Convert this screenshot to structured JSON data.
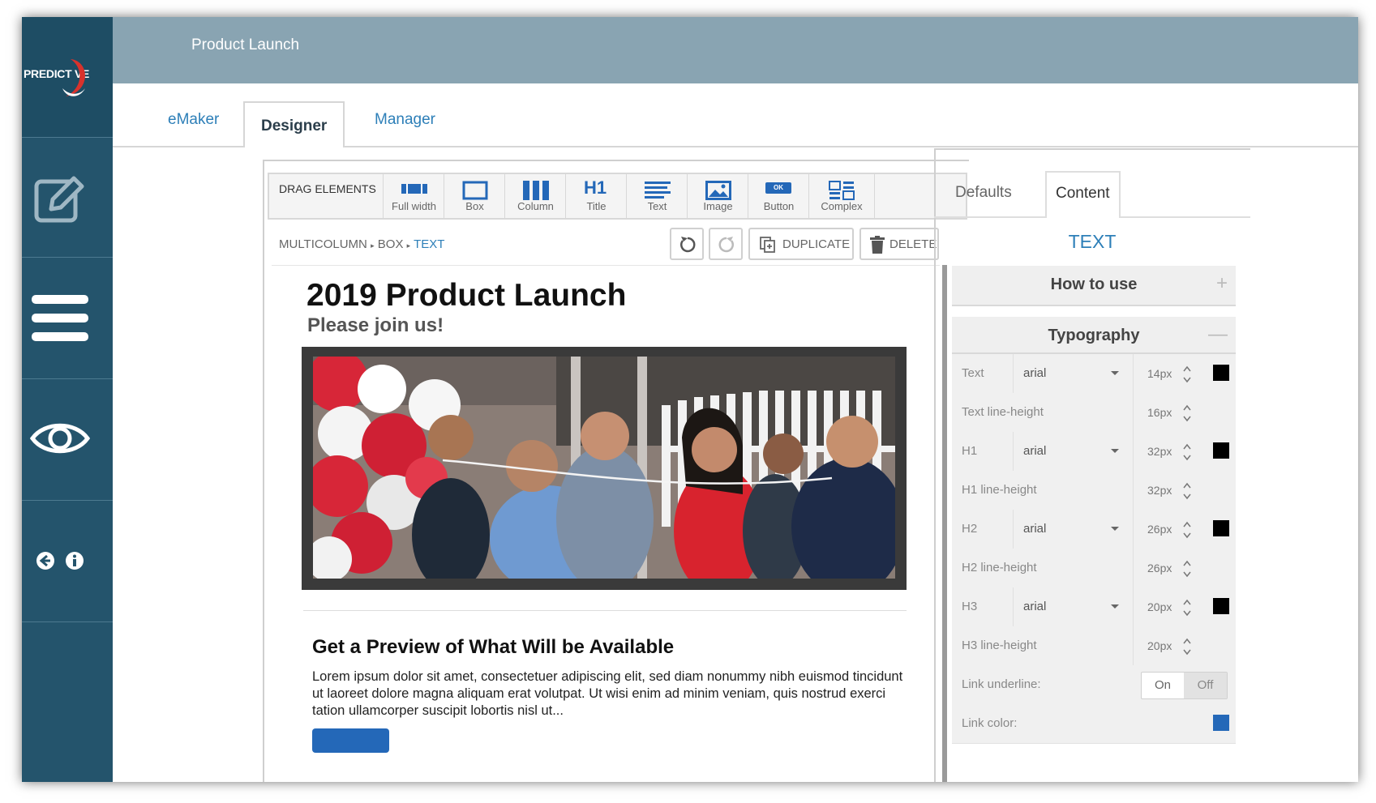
{
  "header": {
    "title": "Product Launch"
  },
  "logo": {
    "text": "PREDICT VE"
  },
  "tabs": [
    {
      "label": "eMaker"
    },
    {
      "label": "Designer"
    },
    {
      "label": "Manager"
    }
  ],
  "toolbar": {
    "drag_label": "DRAG ELEMENTS",
    "tools": [
      {
        "label": "Full width",
        "icon": "full-width-icon"
      },
      {
        "label": "Box",
        "icon": "box-icon"
      },
      {
        "label": "Column",
        "icon": "column-icon"
      },
      {
        "label": "Title",
        "icon": "h1-title-icon",
        "glyph": "H1"
      },
      {
        "label": "Text",
        "icon": "text-lines-icon"
      },
      {
        "label": "Image",
        "icon": "image-icon"
      },
      {
        "label": "Button",
        "icon": "button-icon",
        "glyph": "OK"
      },
      {
        "label": "Complex",
        "icon": "complex-icon"
      }
    ]
  },
  "breadcrumb": {
    "items": [
      "MULTICOLUMN",
      "BOX"
    ],
    "current": "TEXT"
  },
  "actions": {
    "duplicate": "DUPLICATE",
    "delete": "DELETE"
  },
  "email": {
    "title": "2019 Product Launch",
    "subtitle": "Please join us!",
    "section_title": "Get a Preview of What Will be Available",
    "body": "Lorem ipsum dolor sit amet, consectetuer adipiscing elit, sed diam nonummy nibh euismod tincidunt ut laoreet dolore magna aliquam erat volutpat. Ut wisi enim ad minim veniam, quis nostrud exerci tation ullamcorper suscipit lobortis nisl ut..."
  },
  "panel": {
    "tabs": [
      "Defaults",
      "Content"
    ],
    "heading": "TEXT",
    "accordions": {
      "how_to_use": "How to use",
      "typography": "Typography"
    },
    "typography": [
      {
        "label": "Text",
        "font": "arial",
        "size": "14px",
        "color": "#000000"
      },
      {
        "label": "Text line-height",
        "size": "16px"
      },
      {
        "label": "H1",
        "font": "arial",
        "size": "32px",
        "color": "#000000"
      },
      {
        "label": "H1 line-height",
        "size": "32px"
      },
      {
        "label": "H2",
        "font": "arial",
        "size": "26px",
        "color": "#000000"
      },
      {
        "label": "H2 line-height",
        "size": "26px"
      },
      {
        "label": "H3",
        "font": "arial",
        "size": "20px",
        "color": "#000000"
      },
      {
        "label": "H3 line-height",
        "size": "20px"
      }
    ],
    "link_underline": {
      "label": "Link underline:",
      "on": "On",
      "off": "Off",
      "selected": "Off"
    },
    "link_color": {
      "label": "Link color:",
      "color": "#2468b8"
    }
  },
  "colors": {
    "sidebar": "#24546c",
    "header": "#89a4b2",
    "accent": "#2d7fb8"
  }
}
